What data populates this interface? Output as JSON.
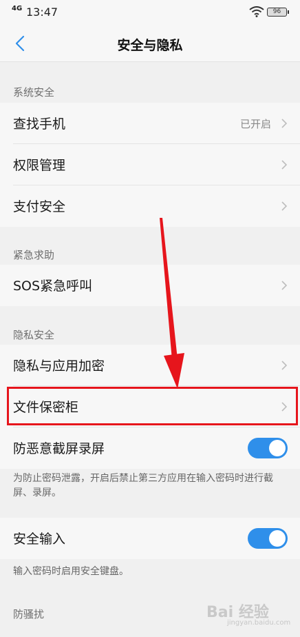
{
  "status_bar": {
    "network": "4G",
    "time": "13:47",
    "battery": "96"
  },
  "nav": {
    "title": "安全与隐私"
  },
  "sections": {
    "system": {
      "header": "系统安全",
      "find_phone": {
        "label": "查找手机",
        "value": "已开启"
      },
      "permission": {
        "label": "权限管理"
      },
      "payment": {
        "label": "支付安全"
      }
    },
    "emergency": {
      "header": "紧急求助",
      "sos": {
        "label": "SOS紧急呼叫"
      }
    },
    "privacy": {
      "header": "隐私安全",
      "app_encryption": {
        "label": "隐私与应用加密"
      },
      "file_vault": {
        "label": "文件保密柜"
      },
      "anti_screenshot": {
        "label": "防恶意截屏录屏",
        "enabled": true,
        "description": "为防止密码泄露，开启后禁止第三方应用在输入密码时进行截屏、录屏。"
      },
      "secure_input": {
        "label": "安全输入",
        "enabled": true,
        "description": "输入密码时启用安全键盘。"
      }
    },
    "harassment": {
      "header": "防骚扰"
    }
  },
  "watermark": {
    "text": "Bai 经验",
    "sub": "jingyan.baidu.com"
  },
  "colors": {
    "toggle_on": "#2f8fea",
    "highlight": "#e6151c",
    "background": "#f0f0f0",
    "row": "#f7f7f7"
  }
}
